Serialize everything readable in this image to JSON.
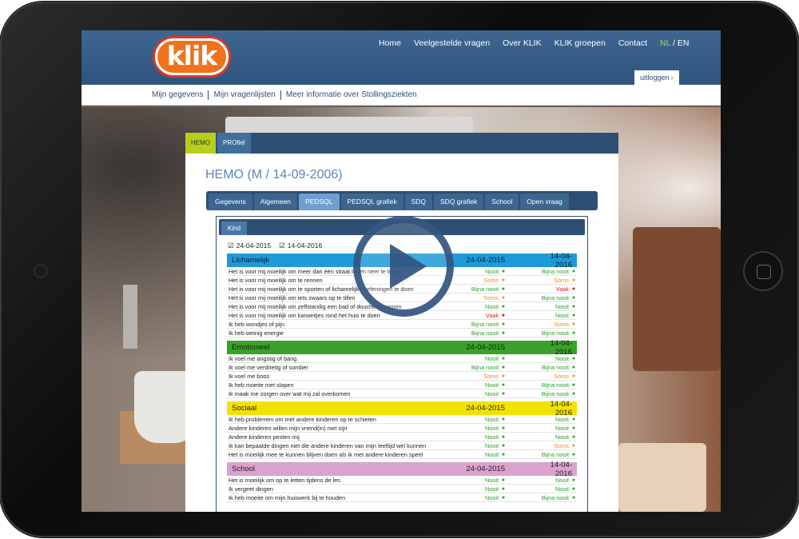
{
  "header": {
    "logo_text": "klik",
    "nav": [
      "Home",
      "Veelgestelde vragen",
      "Over KLIK",
      "KLIK groepen",
      "Contact"
    ],
    "lang_nl": "NL",
    "lang_sep": "/",
    "lang_en": "EN",
    "logout": "uitloggen"
  },
  "subnav": [
    "Mijn gegevens",
    "Mijn vragenlijsten",
    "Meer informatie over Stollingsziekten"
  ],
  "panel": {
    "tabs": [
      "HEMO",
      "PROfiel"
    ],
    "title": "HEMO (M / 14-09-2006)",
    "subtabs": [
      "Gegevens",
      "Algemeen",
      "PEDSQL",
      "PEDSQL grafiek",
      "SDQ",
      "SDQ grafiek",
      "School",
      "Open vraag"
    ],
    "active_subtab": "PEDSQL",
    "kind_tab": "Kind",
    "checks": [
      "24-04-2015",
      "14-04-2016"
    ]
  },
  "sections": [
    {
      "name": "Lichamelijk",
      "d1": "24-04-2015",
      "d2": "14-04-2016",
      "rows": [
        {
          "q": "Het is voor mij moeilijk om meer dan één straat lopen neer te lopen",
          "a": "Nooit",
          "b": "Bijna nooit"
        },
        {
          "q": "Het is voor mij moeilijk om te rennen",
          "a": "Soms",
          "b": "Soms"
        },
        {
          "q": "Het is voor mij moeilijk om te sporten of lichamelijke oefeningen te doen",
          "a": "Bijna nooit",
          "b": "Vaak"
        },
        {
          "q": "Het is voor mij moeilijk om iets zwaars op te tillen",
          "a": "Soms",
          "b": "Bijna nooit"
        },
        {
          "q": "Het is voor mij moeilijk om zelfstandig een bad of douche te nemen",
          "a": "Nooit",
          "b": "Nooit"
        },
        {
          "q": "Het is voor mij moeilijk om karweitjes rond het huis te doen",
          "a": "Vaak",
          "b": "Nooit"
        },
        {
          "q": "Ik heb wondjes of pijn",
          "a": "Bijna nooit",
          "b": "Soms"
        },
        {
          "q": "Ik heb weinig energie",
          "a": "Bijna nooit",
          "b": "Bijna nooit"
        }
      ]
    },
    {
      "name": "Emotioneel",
      "d1": "24-04-2015",
      "d2": "14-04-2016",
      "rows": [
        {
          "q": "Ik voel me angstig of bang",
          "a": "Nooit",
          "b": "Nooit"
        },
        {
          "q": "Ik voel me verdrietig of somber",
          "a": "Bijna nooit",
          "b": "Bijna nooit"
        },
        {
          "q": "Ik voel me boos",
          "a": "Soms",
          "b": "Soms"
        },
        {
          "q": "Ik heb moeite met slapen",
          "a": "Nooit",
          "b": "Bijna nooit"
        },
        {
          "q": "Ik maak me zorgen over wat mij zal overkomen",
          "a": "Nooit",
          "b": "Bijna nooit"
        }
      ]
    },
    {
      "name": "Sociaal",
      "d1": "24-04-2015",
      "d2": "14-04-2016",
      "rows": [
        {
          "q": "Ik heb problemen om met andere kinderen op te schieten",
          "a": "Nooit",
          "b": "Nooit"
        },
        {
          "q": "Andere kinderen willen mijn vriend(in) niet zijn",
          "a": "Nooit",
          "b": "Nooit"
        },
        {
          "q": "Andere kinderen pesten mij",
          "a": "Nooit",
          "b": "Nooit"
        },
        {
          "q": "Ik kan bepaalde dingen niet die andere kinderen van mijn leeftijd wel kunnen",
          "a": "Nooit",
          "b": "Soms"
        },
        {
          "q": "Het is moeilijk mee te kunnen blijven doen als ik met andere kinderen speel",
          "a": "Nooit",
          "b": "Bijna nooit"
        }
      ]
    },
    {
      "name": "School",
      "d1": "24-04-2015",
      "d2": "14-04-2016",
      "rows": [
        {
          "q": "Het is moeilijk om op te letten tijdens de les",
          "a": "Nooit",
          "b": "Nooit"
        },
        {
          "q": "Ik vergeet dingen",
          "a": "Nooit",
          "b": "Nooit"
        },
        {
          "q": "Ik heb moeite om mijn huiswerk bij te houden",
          "a": "Nooit",
          "b": "Bijna nooit"
        }
      ]
    }
  ],
  "colors": {
    "nooit": "#2aa02a",
    "bijna_nooit": "#2aa02a",
    "soms": "#f08a2a",
    "vaak": "#d9161a",
    "lichamelijk": "#1e9ad9",
    "emotioneel": "#3aa12a",
    "sociaal": "#f2e200",
    "school": "#d9a3cd"
  },
  "icons": {
    "play": "play-icon",
    "logout_arrow": "chevron-right-icon",
    "checkbox": "checkbox-checked-icon"
  }
}
